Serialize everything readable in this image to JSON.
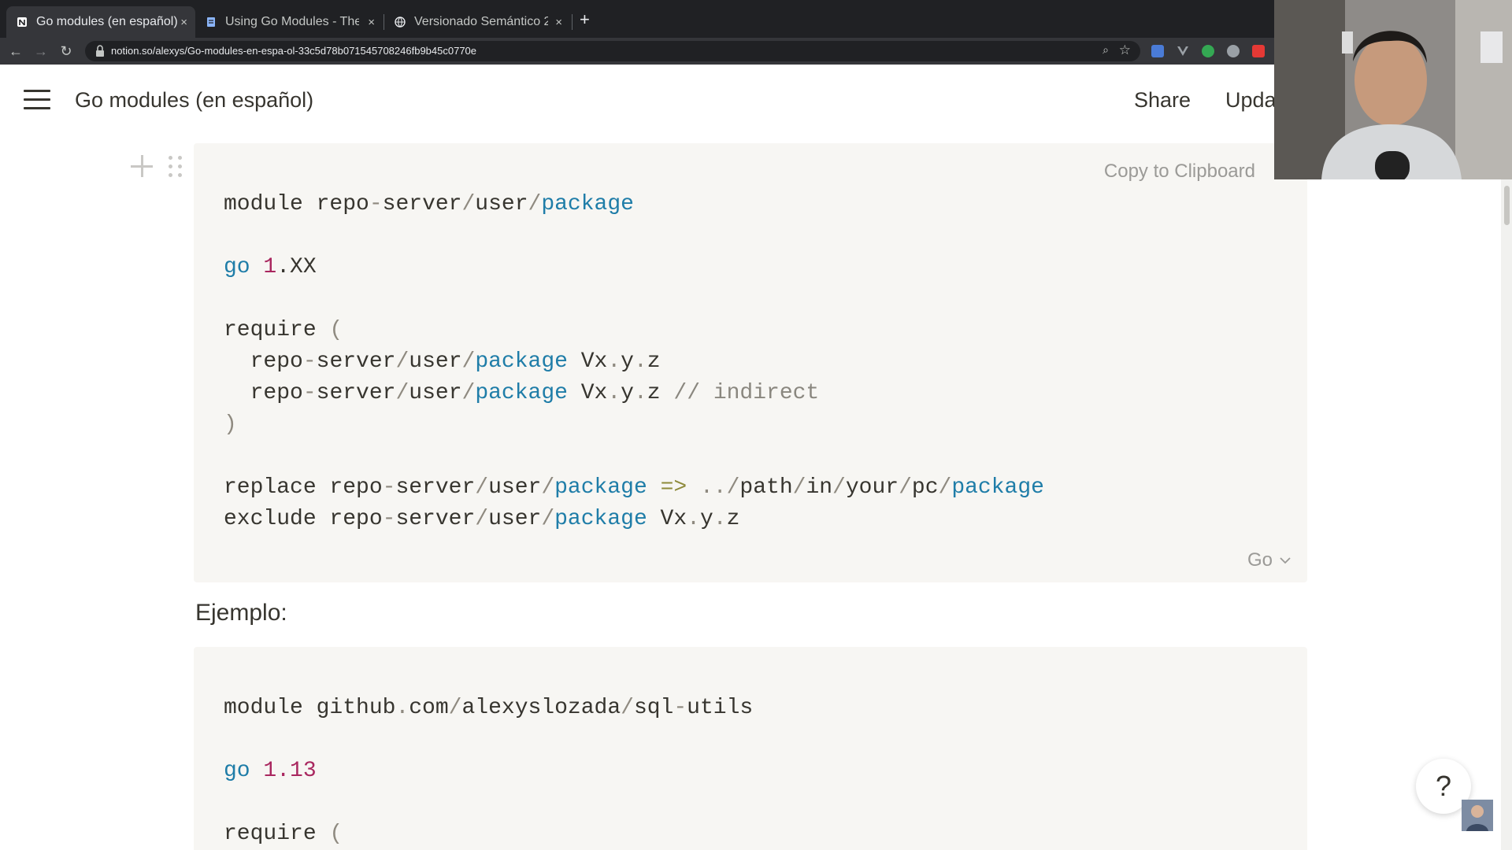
{
  "browser": {
    "tabs": [
      {
        "title": "Go modules (en español)",
        "active": true
      },
      {
        "title": "Using Go Modules - The",
        "active": false
      },
      {
        "title": "Versionado Semántico 2",
        "active": false
      }
    ],
    "tab_close_glyph": "×",
    "new_tab_glyph": "+",
    "nav": {
      "back": "←",
      "forward": "→",
      "reload": "↻"
    },
    "url": "notion.so/alexys/Go-modules-en-espa-ol-33c5d78b071545708246fb9b45c0770e",
    "zoom_glyph": "⌕",
    "star_glyph": "☆"
  },
  "page": {
    "title": "Go modules (en español)",
    "share_label": "Share",
    "updates_label": "Updates"
  },
  "code_block_1": {
    "copy_label": "Copy to Clipboard",
    "language": "Go",
    "lines": [
      [
        [
          "",
          "module repo"
        ],
        [
          "punc",
          "-"
        ],
        [
          "",
          "server"
        ],
        [
          "punc",
          "/"
        ],
        [
          "",
          "user"
        ],
        [
          "punc",
          "/"
        ],
        [
          "kw",
          "package"
        ]
      ],
      [],
      [
        [
          "kw",
          "go"
        ],
        [
          "",
          " "
        ],
        [
          "num",
          "1"
        ],
        [
          "",
          ".XX"
        ]
      ],
      [],
      [
        [
          "",
          "require "
        ],
        [
          "punc",
          "("
        ]
      ],
      [
        [
          "",
          "  repo"
        ],
        [
          "punc",
          "-"
        ],
        [
          "",
          "server"
        ],
        [
          "punc",
          "/"
        ],
        [
          "",
          "user"
        ],
        [
          "punc",
          "/"
        ],
        [
          "kw",
          "package"
        ],
        [
          "",
          " Vx"
        ],
        [
          "punc",
          "."
        ],
        [
          "",
          "y"
        ],
        [
          "punc",
          "."
        ],
        [
          "",
          "z"
        ]
      ],
      [
        [
          "",
          "  repo"
        ],
        [
          "punc",
          "-"
        ],
        [
          "",
          "server"
        ],
        [
          "punc",
          "/"
        ],
        [
          "",
          "user"
        ],
        [
          "punc",
          "/"
        ],
        [
          "kw",
          "package"
        ],
        [
          "",
          " Vx"
        ],
        [
          "punc",
          "."
        ],
        [
          "",
          "y"
        ],
        [
          "punc",
          "."
        ],
        [
          "",
          "z "
        ],
        [
          "cmt",
          "// indirect"
        ]
      ],
      [
        [
          "punc",
          ")"
        ]
      ],
      [],
      [
        [
          "",
          "replace repo"
        ],
        [
          "punc",
          "-"
        ],
        [
          "",
          "server"
        ],
        [
          "punc",
          "/"
        ],
        [
          "",
          "user"
        ],
        [
          "punc",
          "/"
        ],
        [
          "kw",
          "package"
        ],
        [
          "",
          " "
        ],
        [
          "op",
          "=>"
        ],
        [
          "",
          " "
        ],
        [
          "punc",
          "../"
        ],
        [
          "",
          "path"
        ],
        [
          "punc",
          "/"
        ],
        [
          "",
          "in"
        ],
        [
          "punc",
          "/"
        ],
        [
          "",
          "your"
        ],
        [
          "punc",
          "/"
        ],
        [
          "",
          "pc"
        ],
        [
          "punc",
          "/"
        ],
        [
          "kw",
          "package"
        ]
      ],
      [
        [
          "",
          "exclude repo"
        ],
        [
          "punc",
          "-"
        ],
        [
          "",
          "server"
        ],
        [
          "punc",
          "/"
        ],
        [
          "",
          "user"
        ],
        [
          "punc",
          "/"
        ],
        [
          "kw",
          "package"
        ],
        [
          "",
          " Vx"
        ],
        [
          "punc",
          "."
        ],
        [
          "",
          "y"
        ],
        [
          "punc",
          "."
        ],
        [
          "",
          "z"
        ]
      ]
    ]
  },
  "heading": "Ejemplo:",
  "code_block_2": {
    "lines": [
      [
        [
          "",
          "module github"
        ],
        [
          "punc",
          "."
        ],
        [
          "",
          "com"
        ],
        [
          "punc",
          "/"
        ],
        [
          "",
          "alexyslozada"
        ],
        [
          "punc",
          "/"
        ],
        [
          "",
          "sql"
        ],
        [
          "punc",
          "-"
        ],
        [
          "",
          "utils"
        ]
      ],
      [],
      [
        [
          "kw",
          "go"
        ],
        [
          "",
          " "
        ],
        [
          "num",
          "1.13"
        ]
      ],
      [],
      [
        [
          "",
          "require "
        ],
        [
          "punc",
          "("
        ]
      ]
    ]
  },
  "help_label": "?",
  "icons": {
    "menu": "hamburger-menu-icon",
    "check": "checkmark-icon",
    "plus": "plus-icon",
    "drag": "drag-handle-icon",
    "chevron": "chevron-down-icon"
  },
  "colors": {
    "keyword": "#1f7da8",
    "number": "#a9275f",
    "code_bg": "#f7f6f3",
    "text": "#37352f"
  }
}
